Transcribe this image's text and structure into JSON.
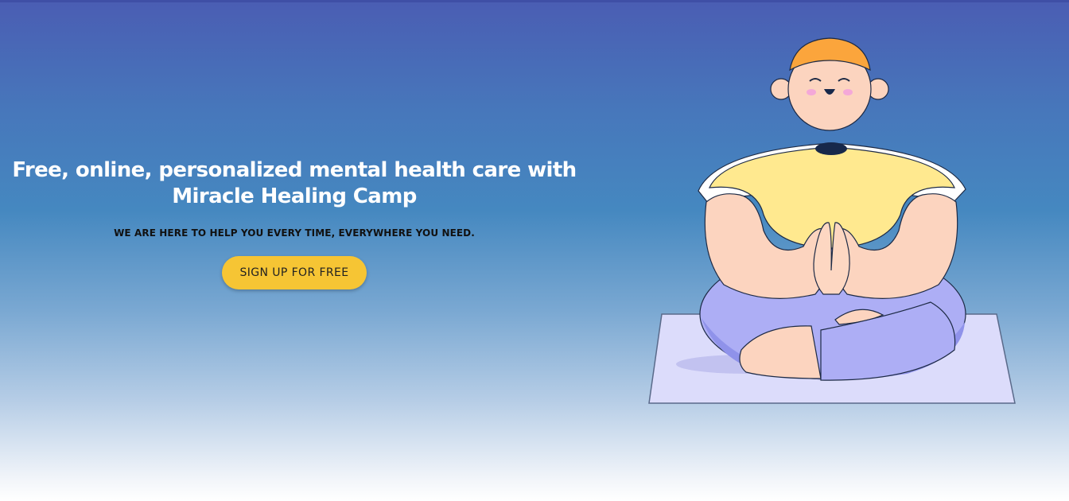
{
  "hero": {
    "headline_line1": "Free, online, personalized mental health care with",
    "headline_line2": "Miracle Healing Camp",
    "subheadline": "WE ARE HERE TO HELP YOU EVERY TIME, EVERYWHERE YOU NEED.",
    "cta_label": "SIGN UP FOR FREE"
  },
  "illustration": {
    "name": "meditating-person-illustration"
  },
  "colors": {
    "cta": "#f6c534",
    "headline": "#ffffff",
    "subheadline": "#111111",
    "gradient_top": "#4a5db3",
    "gradient_bottom": "#ffffff"
  }
}
